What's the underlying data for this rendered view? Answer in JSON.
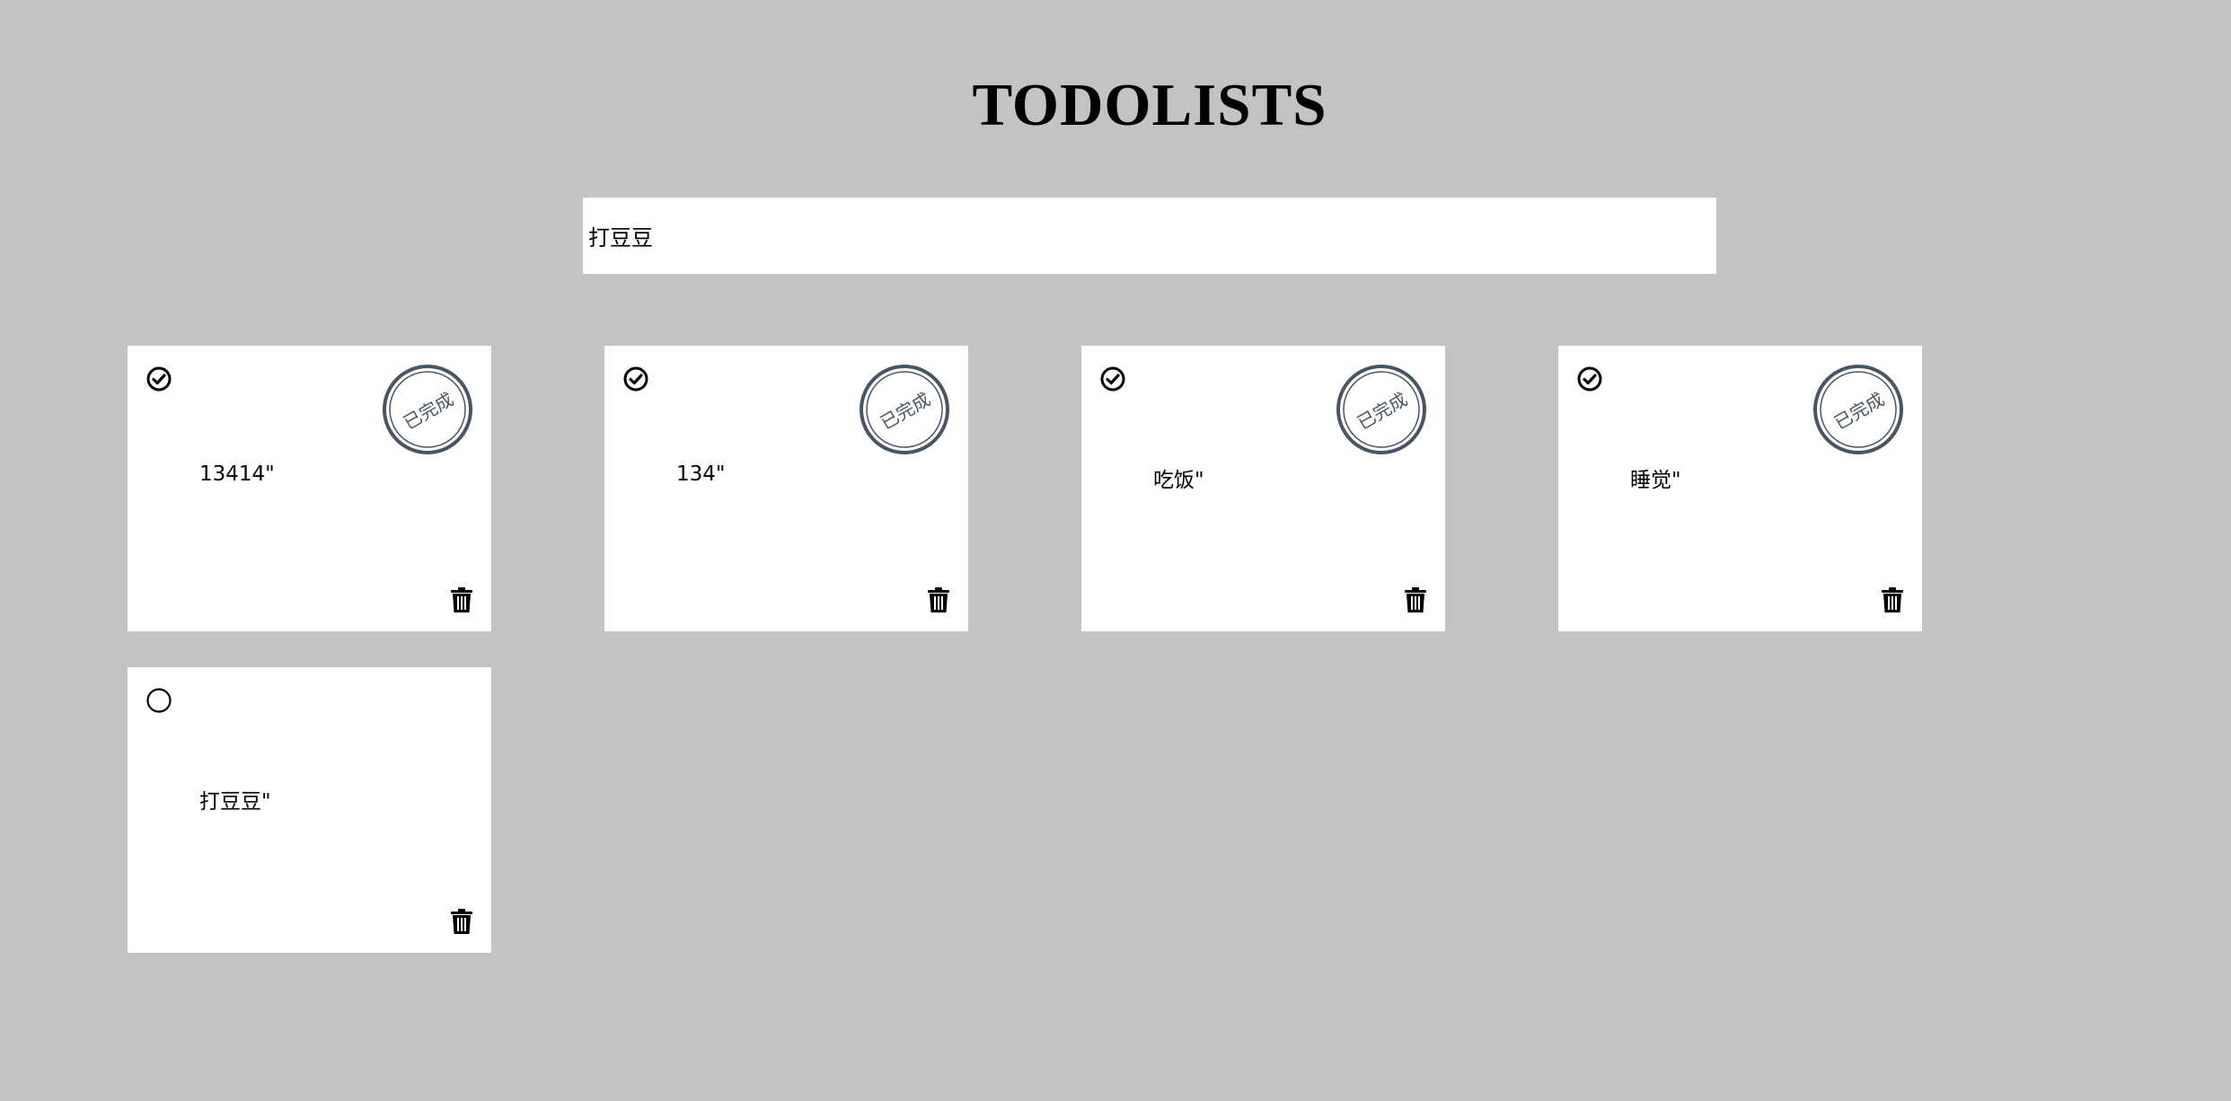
{
  "header": {
    "title": "TODOLISTS"
  },
  "new_todo": {
    "value": "打豆豆"
  },
  "colors": {
    "background": "#c3c3c3",
    "card": "#ffffff",
    "stamp": "#4a5563",
    "text": "#000000"
  },
  "icons": {
    "done_toggle": "check-circle-icon",
    "pending_toggle": "empty-circle-icon",
    "delete": "trash-icon",
    "stamp": "completed-stamp"
  },
  "todos": [
    {
      "text": "13414\"",
      "done": true,
      "stamp_label": "已完成"
    },
    {
      "text": "134\"",
      "done": true,
      "stamp_label": "已完成"
    },
    {
      "text": "吃饭\"",
      "done": true,
      "stamp_label": "已完成"
    },
    {
      "text": "睡觉\"",
      "done": true,
      "stamp_label": "已完成"
    },
    {
      "text": "打豆豆\"",
      "done": false,
      "stamp_label": ""
    }
  ]
}
